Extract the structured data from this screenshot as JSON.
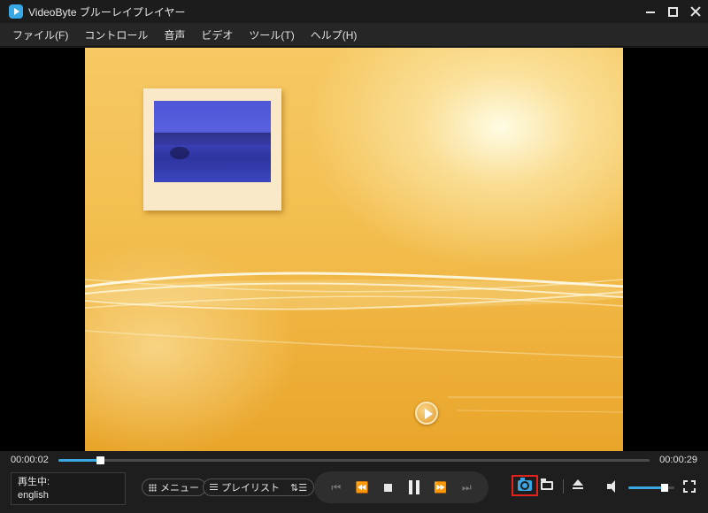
{
  "window": {
    "title": "VideoByte ブルーレイプレイヤー",
    "icon": "play-logo-icon",
    "accent_color": "#3aa6e2",
    "highlight_color": "#e0231d"
  },
  "menu": {
    "items": [
      {
        "label": "ファイル(F)"
      },
      {
        "label": "コントロール"
      },
      {
        "label": "音声"
      },
      {
        "label": "ビデオ"
      },
      {
        "label": "ツール(T)"
      },
      {
        "label": "ヘルプ(H)"
      }
    ]
  },
  "video": {
    "content": "blu-ray-menu-screen",
    "thumbnail": "desert-night-photo",
    "play_icon": "play-circle-icon"
  },
  "progress": {
    "current_time": "00:00:02",
    "total_time": "00:00:29",
    "fraction": 0.07
  },
  "status": {
    "label": "再生中:",
    "value": "english"
  },
  "buttons": {
    "menu_label": "メニュー",
    "playlist_label": "プレイリスト",
    "sort_glyph": "⇅☰"
  },
  "transport": {
    "prev_glyph": "⏮",
    "rewind_glyph": "⏪",
    "forward_glyph": "⏩",
    "next_glyph": "⏭"
  },
  "volume": {
    "level": 0.78
  }
}
